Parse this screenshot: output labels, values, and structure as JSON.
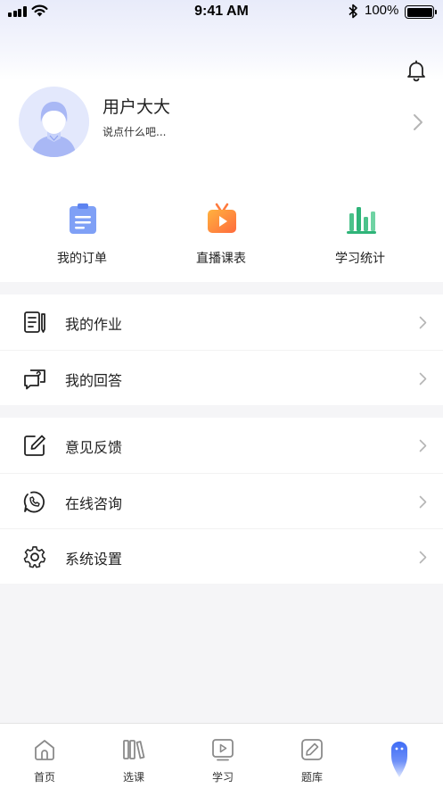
{
  "status_bar": {
    "time": "9:41 AM",
    "battery": "100%"
  },
  "header": {
    "bell_icon": "bell-icon"
  },
  "profile": {
    "name": "用户大大",
    "signature": "说点什么吧..."
  },
  "shortcuts": [
    {
      "label": "我的订单",
      "icon": "clipboard-icon"
    },
    {
      "label": "直播课表",
      "icon": "tv-play-icon"
    },
    {
      "label": "学习统计",
      "icon": "bar-chart-icon"
    }
  ],
  "menu_group_1": [
    {
      "label": "我的作业",
      "icon": "homework-icon"
    },
    {
      "label": "我的回答",
      "icon": "answer-icon"
    }
  ],
  "menu_group_2": [
    {
      "label": "意见反馈",
      "icon": "edit-feedback-icon"
    },
    {
      "label": "在线咨询",
      "icon": "consult-phone-icon"
    },
    {
      "label": "系统设置",
      "icon": "gear-icon"
    }
  ],
  "tabbar": [
    {
      "label": "首页",
      "icon": "home-icon"
    },
    {
      "label": "选课",
      "icon": "books-icon"
    },
    {
      "label": "学习",
      "icon": "play-icon"
    },
    {
      "label": "题库",
      "icon": "pencil-icon"
    },
    {
      "label": "",
      "icon": "profile-active-icon"
    }
  ],
  "colors": {
    "accent": "#3f6cf5",
    "icon_gray": "#8a8a8a",
    "page_bg": "#f5f5f7"
  }
}
